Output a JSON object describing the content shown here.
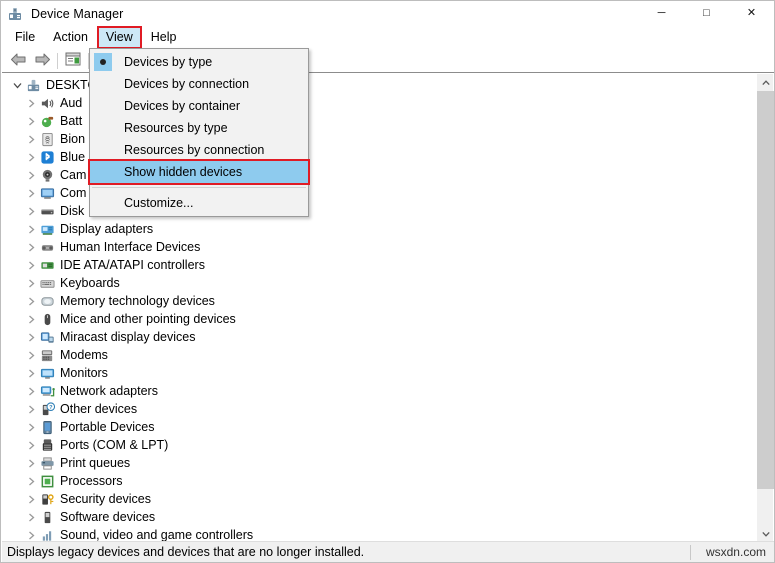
{
  "window": {
    "title": "Device Manager",
    "icon": "device-manager-icon",
    "caption": {
      "minimize": "─",
      "maximize": "□",
      "close": "✕"
    }
  },
  "menubar": {
    "items": [
      {
        "label": "File",
        "open": false
      },
      {
        "label": "Action",
        "open": false
      },
      {
        "label": "View",
        "open": true,
        "annotated": true
      },
      {
        "label": "Help",
        "open": false
      }
    ]
  },
  "toolbar": {
    "buttons": [
      {
        "name": "back-button",
        "icon": "back-arrow-icon"
      },
      {
        "name": "forward-button",
        "icon": "forward-arrow-icon"
      },
      {
        "name": "properties-button",
        "icon": "properties-icon"
      }
    ]
  },
  "view_menu": {
    "items": [
      {
        "label": "Devices by type",
        "radio": true,
        "selected": true,
        "highlighted": false
      },
      {
        "label": "Devices by connection",
        "radio": false,
        "selected": false,
        "highlighted": false
      },
      {
        "label": "Devices by container",
        "radio": false,
        "selected": false,
        "highlighted": false
      },
      {
        "label": "Resources by type",
        "radio": false,
        "selected": false,
        "highlighted": false
      },
      {
        "label": "Resources by connection",
        "radio": false,
        "selected": false,
        "highlighted": false
      },
      {
        "label": "Show hidden devices",
        "radio": false,
        "selected": false,
        "highlighted": true,
        "annotated": true
      },
      {
        "label": "Customize...",
        "radio": false,
        "selected": false,
        "highlighted": false
      }
    ]
  },
  "tree": {
    "root": {
      "label": "DESKTO",
      "icon": "computer-icon",
      "expanded": true
    },
    "items": [
      {
        "label": "Aud",
        "icon": "audio-icon"
      },
      {
        "label": "Batt",
        "icon": "battery-icon"
      },
      {
        "label": "Bion",
        "icon": "biometric-icon"
      },
      {
        "label": "Blue",
        "icon": "bluetooth-icon"
      },
      {
        "label": "Cam",
        "icon": "camera-icon"
      },
      {
        "label": "Com",
        "icon": "computer-monitor-icon"
      },
      {
        "label": "Disk",
        "icon": "disk-drive-icon"
      },
      {
        "label": "Display adapters",
        "icon": "display-adapter-icon"
      },
      {
        "label": "Human Interface Devices",
        "icon": "hid-icon"
      },
      {
        "label": "IDE ATA/ATAPI controllers",
        "icon": "ide-controller-icon"
      },
      {
        "label": "Keyboards",
        "icon": "keyboard-icon"
      },
      {
        "label": "Memory technology devices",
        "icon": "memory-icon"
      },
      {
        "label": "Mice and other pointing devices",
        "icon": "mouse-icon"
      },
      {
        "label": "Miracast display devices",
        "icon": "miracast-icon"
      },
      {
        "label": "Modems",
        "icon": "modem-icon"
      },
      {
        "label": "Monitors",
        "icon": "monitor-icon"
      },
      {
        "label": "Network adapters",
        "icon": "network-adapter-icon"
      },
      {
        "label": "Other devices",
        "icon": "other-device-icon"
      },
      {
        "label": "Portable Devices",
        "icon": "portable-device-icon"
      },
      {
        "label": "Ports (COM & LPT)",
        "icon": "port-icon"
      },
      {
        "label": "Print queues",
        "icon": "printer-icon"
      },
      {
        "label": "Processors",
        "icon": "processor-icon"
      },
      {
        "label": "Security devices",
        "icon": "security-device-icon"
      },
      {
        "label": "Software devices",
        "icon": "software-device-icon"
      },
      {
        "label": "Sound, video and game controllers",
        "icon": "sound-video-icon"
      }
    ]
  },
  "scrollbar": {
    "up_arrow": "▲",
    "down_arrow": "▼"
  },
  "statusbar": {
    "text": "Displays legacy devices and devices that are no longer installed.",
    "watermark": "wsxdn.com"
  },
  "colors": {
    "menu_highlight": "#8ecbee",
    "annotation_red": "#e01b24",
    "menu_bg": "#f2f2f2",
    "status_bg": "#f0f0f0",
    "scroll_thumb": "#cdcdcd"
  }
}
